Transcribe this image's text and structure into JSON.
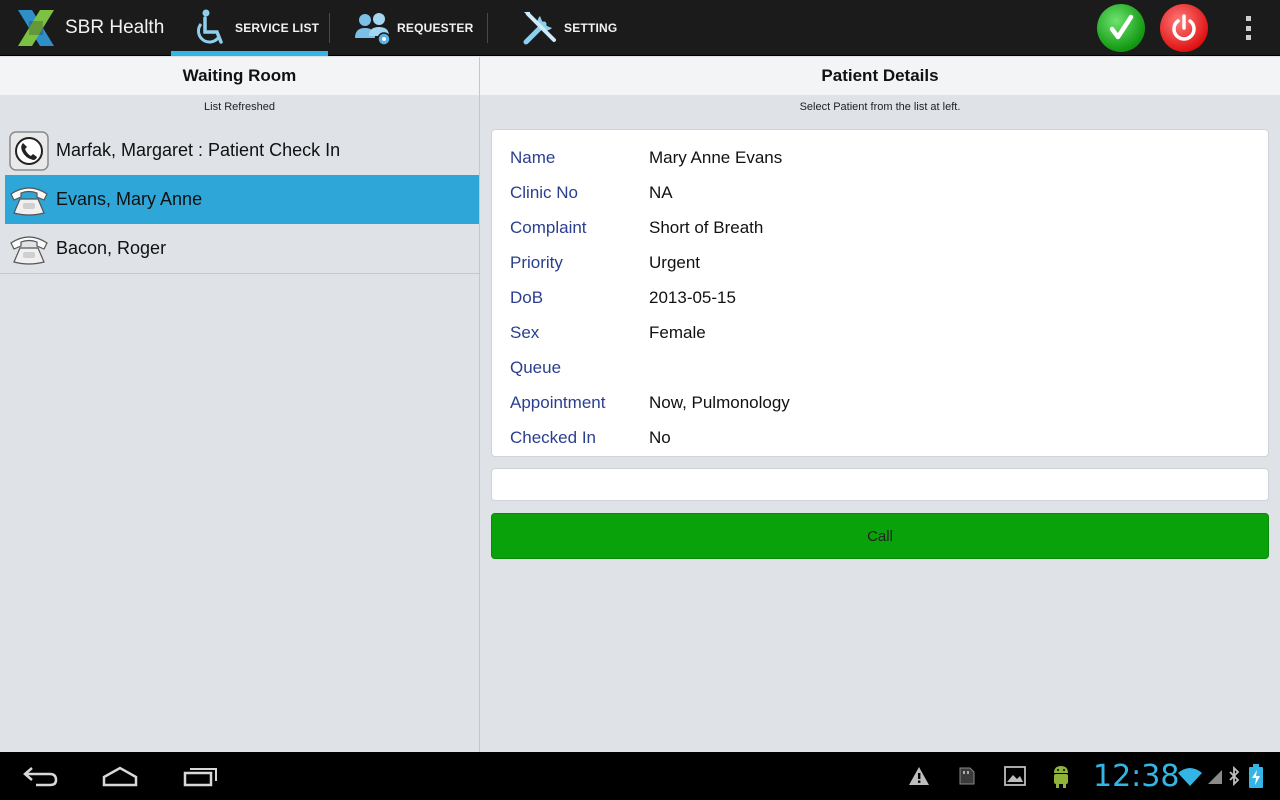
{
  "app": {
    "name": "SBR Health"
  },
  "tabs": [
    {
      "label": "SERVICE LIST",
      "icon": "wheelchair-icon",
      "active": true
    },
    {
      "label": "REQUESTER",
      "icon": "people-icon",
      "active": false
    },
    {
      "label": "SETTING",
      "icon": "tools-icon",
      "active": false
    }
  ],
  "actions": {
    "confirm_icon": "check-icon",
    "power_icon": "power-icon",
    "overflow_icon": "overflow-menu-icon"
  },
  "waiting_room": {
    "title": "Waiting Room",
    "status": "List Refreshed",
    "items": [
      {
        "label": "Marfak, Margaret : Patient Check In",
        "icon": "phone-handset-icon",
        "selected": false
      },
      {
        "label": "Evans, Mary Anne",
        "icon": "phone-icon",
        "selected": true
      },
      {
        "label": "Bacon, Roger",
        "icon": "phone-icon",
        "selected": false
      }
    ]
  },
  "patient": {
    "title": "Patient Details",
    "hint": "Select Patient from the list at left.",
    "fields": [
      {
        "label": "Name",
        "value": "Mary Anne Evans"
      },
      {
        "label": "Clinic No",
        "value": "NA"
      },
      {
        "label": "Complaint",
        "value": "Short of Breath"
      },
      {
        "label": "Priority",
        "value": "Urgent"
      },
      {
        "label": "DoB",
        "value": "2013-05-15"
      },
      {
        "label": "Sex",
        "value": "Female"
      },
      {
        "label": "Queue",
        "value": ""
      },
      {
        "label": "Appointment",
        "value": "Now, Pulmonology"
      },
      {
        "label": "Checked In",
        "value": "No"
      }
    ],
    "call_label": "Call"
  },
  "system": {
    "time": "12:38"
  },
  "colors": {
    "accent": "#33b5e5",
    "selected_row": "#2ea6d7",
    "call_button": "#0aa20a",
    "label_text": "#2a3f8f"
  }
}
